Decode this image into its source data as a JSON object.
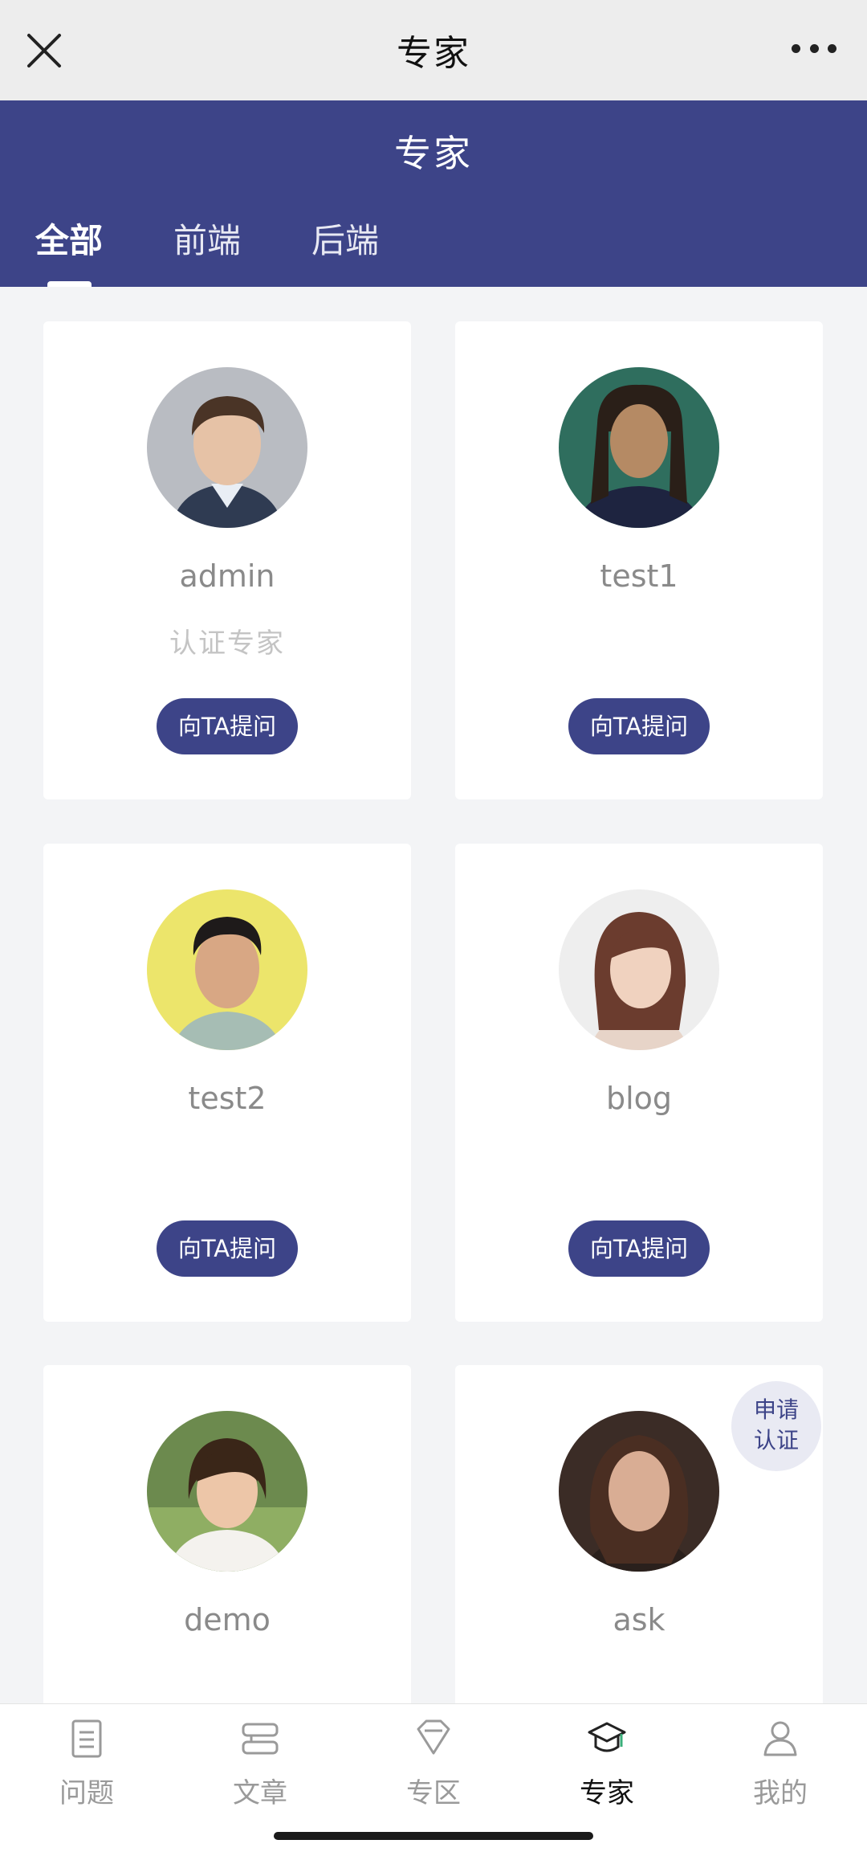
{
  "window": {
    "title": "专家",
    "close_icon": "close-icon",
    "more_icon": "more-icon"
  },
  "header": {
    "title": "专家"
  },
  "tabs": [
    {
      "label": "全部",
      "active": true
    },
    {
      "label": "前端",
      "active": false
    },
    {
      "label": "后端",
      "active": false
    }
  ],
  "experts": [
    {
      "name": "admin",
      "badge": "认证专家",
      "button": "向TA提问"
    },
    {
      "name": "test1",
      "badge": "",
      "button": "向TA提问"
    },
    {
      "name": "test2",
      "badge": "",
      "button": "向TA提问"
    },
    {
      "name": "blog",
      "badge": "",
      "button": "向TA提问"
    },
    {
      "name": "demo",
      "badge": "",
      "button": ""
    },
    {
      "name": "ask",
      "badge": "",
      "button": ""
    }
  ],
  "apply_badge": {
    "line1": "申请",
    "line2": "认证"
  },
  "bottom_nav": [
    {
      "label": "问题",
      "icon": "document-icon",
      "active": false
    },
    {
      "label": "文章",
      "icon": "article-icon",
      "active": false
    },
    {
      "label": "专区",
      "icon": "diamond-icon",
      "active": false
    },
    {
      "label": "专家",
      "icon": "graduation-cap-icon",
      "active": true
    },
    {
      "label": "我的",
      "icon": "user-icon",
      "active": false
    }
  ],
  "colors": {
    "primary": "#3d4488",
    "background": "#f3f4f6",
    "muted_text": "#8a8a8a"
  }
}
